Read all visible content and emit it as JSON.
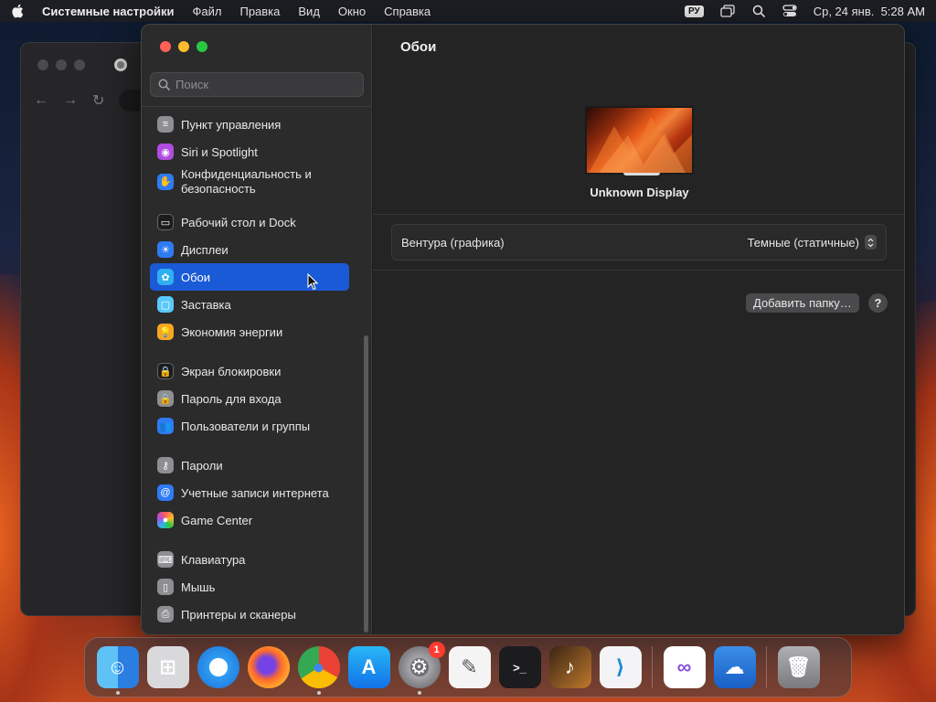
{
  "menubar": {
    "app_name": "Системные настройки",
    "items": [
      "Файл",
      "Правка",
      "Вид",
      "Окно",
      "Справка"
    ],
    "keyboard_layout": "РУ",
    "clock": "Ср, 24 янв.  5:28 AM"
  },
  "settings": {
    "search": {
      "placeholder": "Поиск",
      "value": ""
    },
    "sidebar_items": [
      {
        "label": "Пункт управления",
        "icon": "control-center-icon",
        "color": "#8e8e93"
      },
      {
        "label": "Siri и Spotlight",
        "icon": "siri-icon",
        "color": "#b04ce0"
      },
      {
        "label": "Конфиденциальность и безопасность",
        "icon": "privacy-hand-icon",
        "color": "#2f7bf5"
      },
      {
        "label": "Рабочий стол и Dock",
        "icon": "desktop-dock-icon",
        "color": "#1c1c1e"
      },
      {
        "label": "Дисплеи",
        "icon": "displays-icon",
        "color": "#2f7bf5"
      },
      {
        "label": "Обои",
        "icon": "wallpaper-icon",
        "color": "#30b0f0",
        "active": true
      },
      {
        "label": "Заставка",
        "icon": "screensaver-icon",
        "color": "#5ac8fa"
      },
      {
        "label": "Экономия энергии",
        "icon": "energy-icon",
        "color": "#f5a623"
      },
      {
        "label": "Экран блокировки",
        "icon": "lock-screen-icon",
        "color": "#1c1c1e"
      },
      {
        "label": "Пароль для входа",
        "icon": "login-password-icon",
        "color": "#8e8e93"
      },
      {
        "label": "Пользователи и группы",
        "icon": "users-groups-icon",
        "color": "#2f7bf5"
      },
      {
        "label": "Пароли",
        "icon": "passwords-key-icon",
        "color": "#8e8e93"
      },
      {
        "label": "Учетные записи интернета",
        "icon": "internet-accounts-icon",
        "color": "#2f7bf5"
      },
      {
        "label": "Game Center",
        "icon": "game-center-icon",
        "color": "#ffffff"
      },
      {
        "label": "Клавиатура",
        "icon": "keyboard-icon",
        "color": "#8e8e93"
      },
      {
        "label": "Мышь",
        "icon": "mouse-icon",
        "color": "#8e8e93"
      },
      {
        "label": "Принтеры и сканеры",
        "icon": "printers-icon",
        "color": "#8e8e93"
      }
    ],
    "main": {
      "title": "Обои",
      "display_name": "Unknown Display",
      "wallpaper_name": "Вентура (графика)",
      "wallpaper_mode": "Темные (статичные)",
      "add_folder_label": "Добавить папку…",
      "help_label": "?"
    }
  },
  "dock": {
    "apps": [
      {
        "name": "Finder",
        "icon": "finder-icon",
        "running": true
      },
      {
        "name": "Launchpad",
        "icon": "launchpad-icon",
        "running": false
      },
      {
        "name": "Safari",
        "icon": "safari-icon",
        "running": false
      },
      {
        "name": "Firefox",
        "icon": "firefox-icon",
        "running": false
      },
      {
        "name": "Google Chrome",
        "icon": "chrome-icon",
        "running": true
      },
      {
        "name": "App Store",
        "icon": "app-store-icon",
        "running": false
      },
      {
        "name": "System Settings",
        "icon": "system-settings-icon",
        "running": true,
        "badge": "1"
      },
      {
        "name": "TextEdit",
        "icon": "textedit-icon",
        "running": false
      },
      {
        "name": "Terminal",
        "icon": "terminal-icon",
        "running": false
      },
      {
        "name": "GarageBand",
        "icon": "garageband-icon",
        "running": false
      },
      {
        "name": "Visual Studio Code",
        "icon": "vscode-icon",
        "running": false
      },
      {
        "name": "Visual Studio",
        "icon": "visual-studio-icon",
        "running": false
      },
      {
        "name": "Weather",
        "icon": "weather-icon",
        "running": false
      },
      {
        "name": "Trash",
        "icon": "trash-icon",
        "running": false
      }
    ]
  }
}
